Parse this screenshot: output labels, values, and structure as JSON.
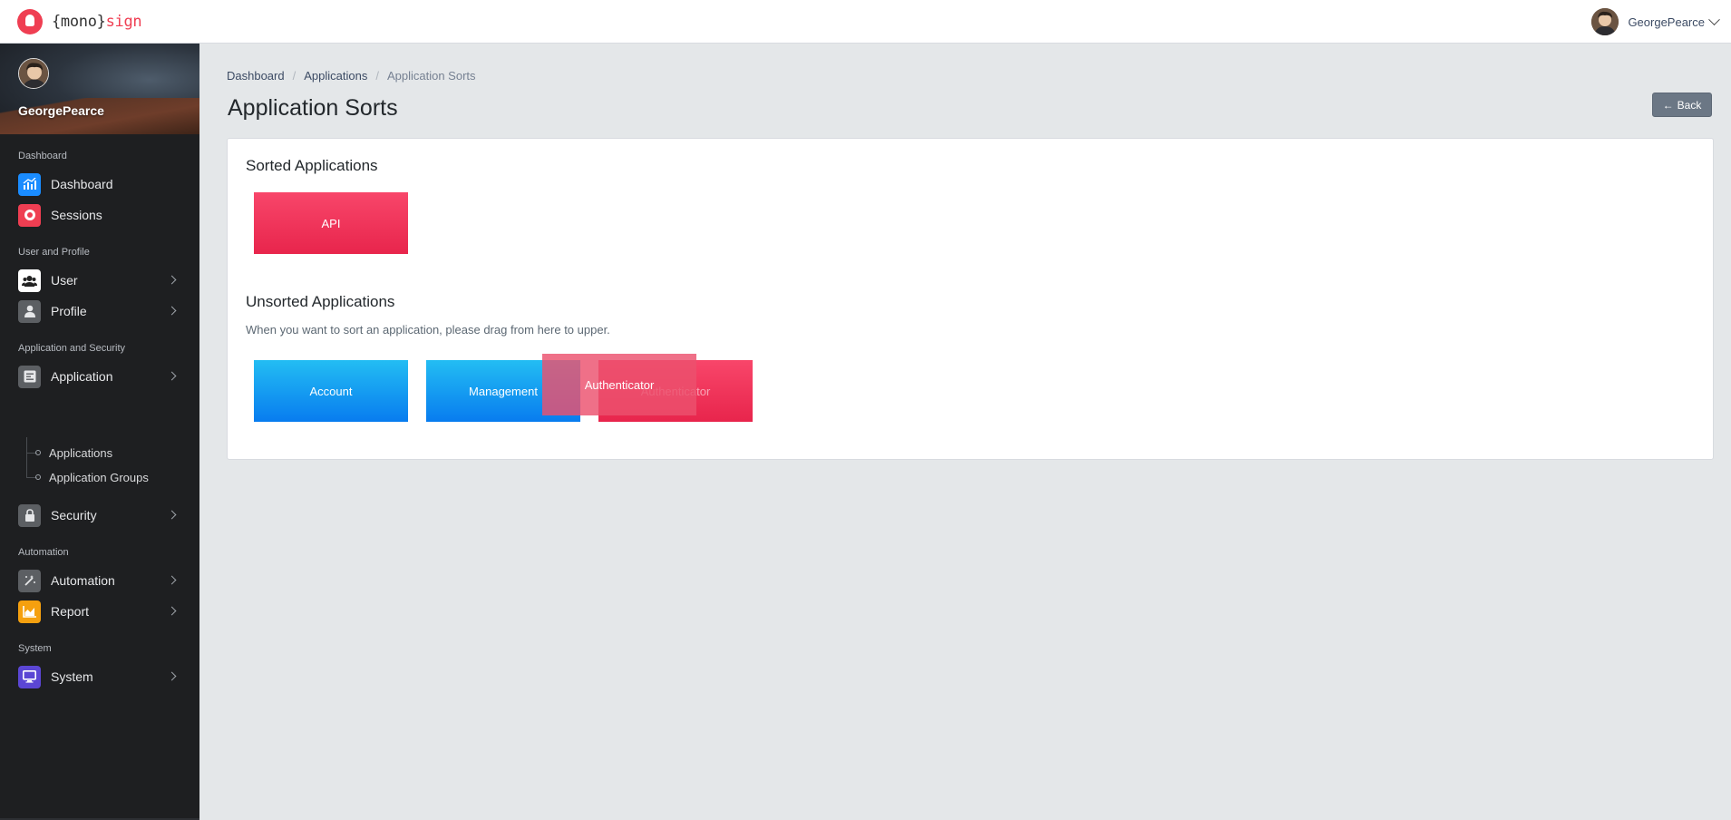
{
  "header": {
    "logo": {
      "open": "{mono}",
      "accent": "sign"
    },
    "user_name": "GeorgePearce"
  },
  "sidebar": {
    "username": "GeorgePearce",
    "sections": [
      {
        "title": "Dashboard"
      },
      {
        "title": "User and Profile"
      },
      {
        "title": "Application and Security"
      },
      {
        "title": "Automation"
      },
      {
        "title": "System"
      }
    ],
    "items": [
      {
        "label": "Dashboard",
        "icon": "chart-icon",
        "color": "#1a8cff"
      },
      {
        "label": "Sessions",
        "icon": "record-icon",
        "color": "#ef3e52"
      },
      {
        "label": "User",
        "icon": "users-icon",
        "color": "#ffffff"
      },
      {
        "label": "Profile",
        "icon": "person-icon",
        "color": "#5c5f63"
      },
      {
        "label": "Application",
        "icon": "application-icon",
        "color": "#5c5f63"
      },
      {
        "label": "Security",
        "icon": "lock-icon",
        "color": "#5c5f63"
      },
      {
        "label": "Automation",
        "icon": "magic-wand-icon",
        "color": "#5c5f63"
      },
      {
        "label": "Report",
        "icon": "area-chart-icon",
        "color": "#f5a00f"
      },
      {
        "label": "System",
        "icon": "monitor-icon",
        "color": "#5b46d4"
      }
    ],
    "sub_items": [
      {
        "label": "Applications"
      },
      {
        "label": "Application Groups"
      }
    ]
  },
  "breadcrumb": [
    {
      "label": "Dashboard"
    },
    {
      "label": "Applications"
    },
    {
      "label": "Application Sorts"
    }
  ],
  "page": {
    "title": "Application Sorts",
    "back_label": "Back"
  },
  "sorted": {
    "title": "Sorted Applications",
    "apps": [
      {
        "label": "API",
        "color": "#ef3458"
      }
    ]
  },
  "unsorted": {
    "title": "Unsorted Applications",
    "description": "When you want to sort an application, please drag from here to upper.",
    "apps": [
      {
        "label": "Account",
        "color": "#129df1"
      },
      {
        "label": "Management",
        "color": "#129df1"
      },
      {
        "label": "Authenticator",
        "color": "#ef3458"
      }
    ],
    "dragging": {
      "label": "Authenticator"
    }
  }
}
